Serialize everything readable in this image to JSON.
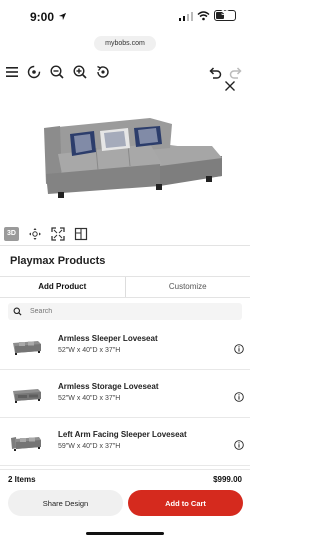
{
  "status_bar": {
    "time": "9:00",
    "battery": "38"
  },
  "browser": {
    "url": "mybobs.com"
  },
  "toolbar": {
    "icons": [
      "menu-icon",
      "rotate-view-icon",
      "zoom-out-icon",
      "zoom-in-icon",
      "reset-view-icon",
      "undo-icon",
      "redo-icon",
      "close-icon"
    ]
  },
  "view_tools": {
    "three_d_label": "3D"
  },
  "panel": {
    "title": "Playmax Products",
    "tabs": [
      {
        "label": "Add Product",
        "active": true
      },
      {
        "label": "Customize",
        "active": false
      }
    ],
    "search": {
      "placeholder": "Search",
      "value": ""
    },
    "products": [
      {
        "name": "Armless Sleeper Loveseat",
        "dimensions": "52\"W x 40\"D x 37\"H"
      },
      {
        "name": "Armless Storage Loveseat",
        "dimensions": "52\"W x 40\"D x 37\"H"
      },
      {
        "name": "Left Arm Facing Sleeper Loveseat",
        "dimensions": "59\"W x 40\"D x 37\"H"
      }
    ]
  },
  "summary": {
    "item_count": "2 Items",
    "total": "$999.00"
  },
  "actions": {
    "share_label": "Share Design",
    "cart_label": "Add to Cart"
  },
  "colors": {
    "accent": "#d52a1e",
    "sofa": "#9b9b9b",
    "pillow": "#2c3d6b"
  }
}
